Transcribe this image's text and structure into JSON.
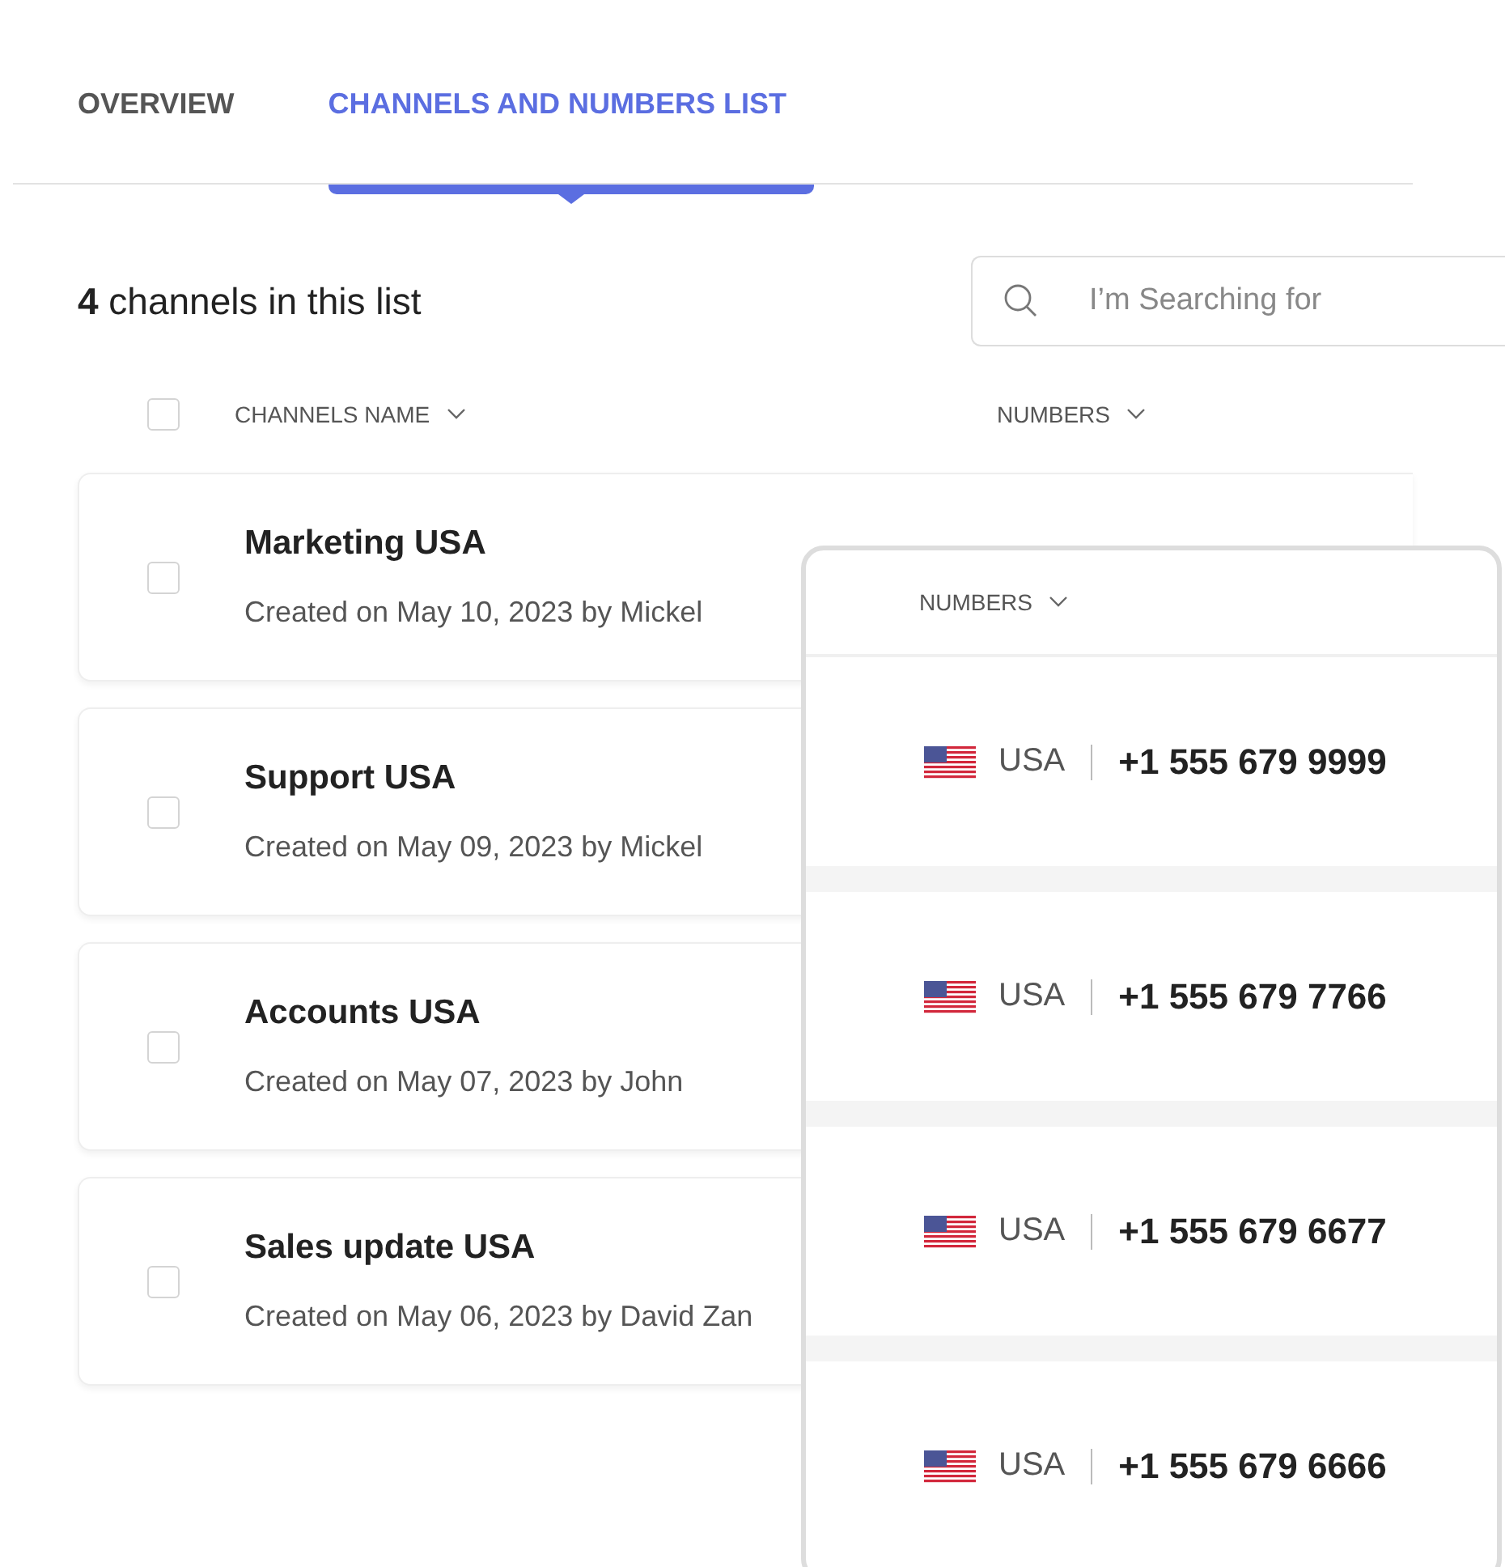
{
  "tabs": [
    {
      "label": "OVERVIEW",
      "selected": false
    },
    {
      "label": "CHANNELS AND NUMBERS LIST",
      "selected": true
    }
  ],
  "summary": {
    "count": "4",
    "text": "channels in this list"
  },
  "search": {
    "placeholder": "I’m Searching for"
  },
  "table": {
    "select_all": {
      "checked": false
    },
    "columns": [
      {
        "label": "CHANNELS NAME"
      },
      {
        "label": "NUMBERS"
      }
    ],
    "rows": [
      {
        "name": "Marketing USA",
        "created": "Created on May 10, 2023 by Mickel",
        "checked": false
      },
      {
        "name": "Support USA",
        "created": "Created on May 09, 2023 by Mickel",
        "checked": false
      },
      {
        "name": "Accounts USA",
        "created": "Created on May 07, 2023 by John",
        "checked": false
      },
      {
        "name": "Sales update USA",
        "created": "Created on May 06, 2023 by David Zan",
        "checked": false
      }
    ]
  },
  "numbers_zoom": {
    "column": "NUMBERS",
    "rows": [
      {
        "country": "USA",
        "number": "+1 555 679 9999"
      },
      {
        "country": "USA",
        "number": "+1 555 679 7766"
      },
      {
        "country": "USA",
        "number": "+1 555 679 6677"
      },
      {
        "country": "USA",
        "number": "+1 555 679 6666"
      }
    ]
  }
}
